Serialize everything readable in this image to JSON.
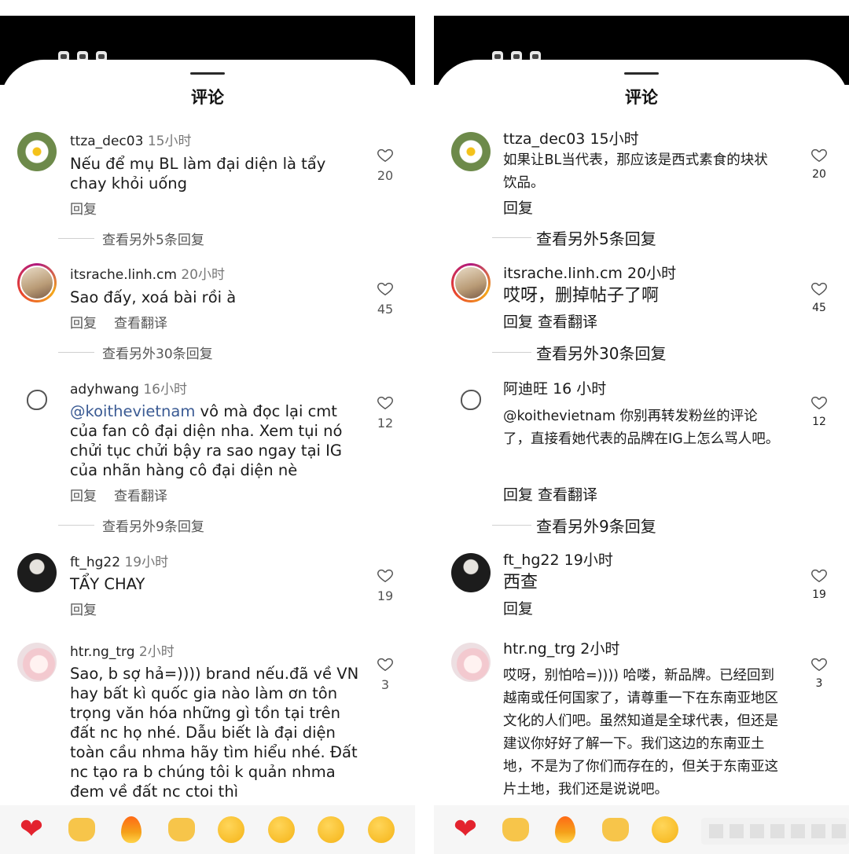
{
  "left": {
    "title": "评论",
    "comments": [
      {
        "user": "ttza_dec03",
        "time": "15小时",
        "text": "Nếu để mụ BL làm đại diện là tẩy chay khỏi uống",
        "reply": "回复",
        "likes": "20",
        "more": "查看另外5条回复"
      },
      {
        "user": "itsrache.linh.cm",
        "time": "20小时",
        "text": "Sao đấy, xoá bài rồi à",
        "reply": "回复",
        "translate": "查看翻译",
        "likes": "45",
        "more": "查看另外30条回复"
      },
      {
        "user": "adyhwang",
        "time": "16小时",
        "mention": "@koithevietnam",
        "text": " vô mà đọc lại cmt của fan cô đại diện nha. Xem tụi nó chửi tục chửi bậy ra sao ngay tại IG của nhãn hàng cô đại diện nè",
        "reply": "回复",
        "translate": "查看翻译",
        "likes": "12",
        "more": "查看另外9条回复"
      },
      {
        "user": "ft_hg22",
        "time": "19小时",
        "text": "TẨY CHAY",
        "reply": "回复",
        "likes": "19"
      },
      {
        "user": "htr.ng_trg",
        "time": "2小时",
        "text": "Sao, b sợ hả=)))) brand nếu.đã về VN hay bất kì quốc gia nào làm ơn tôn trọng văn hóa những gì tồn tại trên đất nc họ nhé. Dẫu biết là đại diện toàn cầu nhma hãy tìm hiểu nhé. Đất nc tạo ra b chúng tôi k quản nhma đem về đất nc ctoi thì",
        "likes": "3"
      }
    ]
  },
  "right": {
    "title": "评论",
    "comments": [
      {
        "user": "ttza_dec03",
        "time": "15小时",
        "text": "如果让BL当代表，那应该是西式素食的块状饮品。",
        "reply": "回复",
        "likes": "20",
        "more": "查看另外5条回复"
      },
      {
        "user": "itsrache.linh.cm",
        "time": "20小时",
        "text": "哎呀，删掉帖子了啊",
        "reply": "回复",
        "translate": "查看翻译",
        "likes": "45",
        "more": "查看另外30条回复"
      },
      {
        "user": "阿迪旺",
        "time": "16 小时",
        "text": "@koithevietnam 你别再转发粉丝的评论了，直接看她代表的品牌在IG上怎么骂人吧。",
        "reply": "回复",
        "translate": "查看翻译",
        "likes": "12",
        "more": "查看另外9条回复"
      },
      {
        "user": "ft_hg22",
        "time": "19小时",
        "text": "西查",
        "reply": "回复",
        "likes": "19"
      },
      {
        "user": "htr.ng_trg",
        "time": "2小时",
        "text": "哎呀，别怕哈=)))) 哈喽，新品牌。已经回到越南或任何国家了，请尊重一下在东南亚地区文化的人们吧。虽然知道是全球代表，但还是建议你好好了解一下。我们这边的东南亚土地，不是为了你们而存在的，但关于东南亚这片土地，我们还是说说吧。",
        "likes": "3"
      }
    ]
  },
  "emojis": [
    "❤",
    "🙌",
    "🔥",
    "👏",
    "😥",
    "😍",
    "😮",
    "😂"
  ],
  "colors": {
    "heart_red": "#e3232e",
    "mention_blue": "#3a5a93",
    "muted_text": "#777777"
  }
}
